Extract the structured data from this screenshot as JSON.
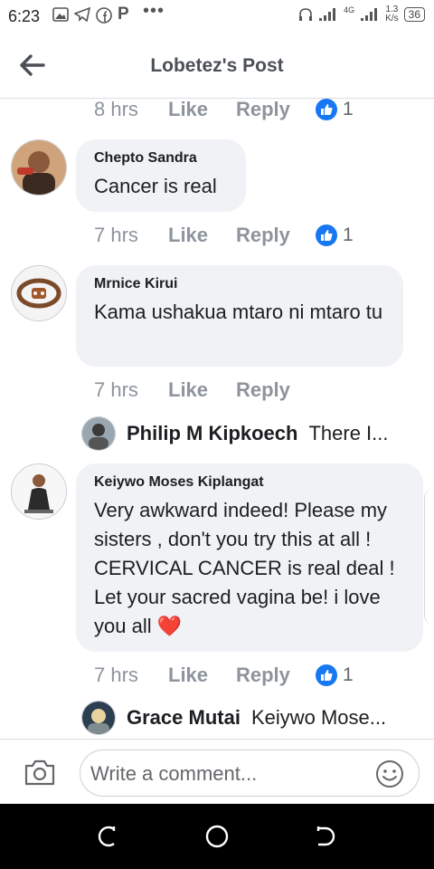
{
  "status_bar": {
    "time": "6:23",
    "icons": [
      "gallery-icon",
      "telegram-icon",
      "facebook-icon",
      "p-icon",
      "more-dots-icon"
    ],
    "network": "4G",
    "speed": "1.3\nK/s",
    "battery": "36"
  },
  "header": {
    "title": "Lobetez's Post"
  },
  "meta_rows": [
    {
      "time": "8 hrs",
      "like": "Like",
      "reply": "Reply",
      "count": "1"
    },
    {
      "time": "7 hrs",
      "like": "Like",
      "reply": "Reply",
      "count": "1"
    },
    {
      "time": "7 hrs",
      "like": "Like",
      "reply": "Reply",
      "count": ""
    },
    {
      "time": "7 hrs",
      "like": "Like",
      "reply": "Reply",
      "count": "1"
    }
  ],
  "comments": [
    {
      "name": "Chepto Sandra",
      "text": "Cancer is real"
    },
    {
      "name": "Mrnice Kirui",
      "text": "Kama ushakua mtaro ni mtaro tu"
    },
    {
      "name": "Keiywo Moses Kiplangat",
      "text": "Very awkward indeed! Please my sisters , don't you try this  at all ! CERVICAL CANCER is real deal ! Let your sacred vagina be! i love you all ❤️"
    }
  ],
  "replies": [
    {
      "name": "Philip M Kipkoech",
      "text": "There I..."
    },
    {
      "name": "Grace Mutai",
      "text": "Keiywo Mose..."
    }
  ],
  "composer": {
    "placeholder": "Write a comment..."
  },
  "colors": {
    "facebook_blue": "#1877f2",
    "bubble": "#f0f2f5",
    "muted": "#8d949e",
    "heart": "#e0242e"
  }
}
